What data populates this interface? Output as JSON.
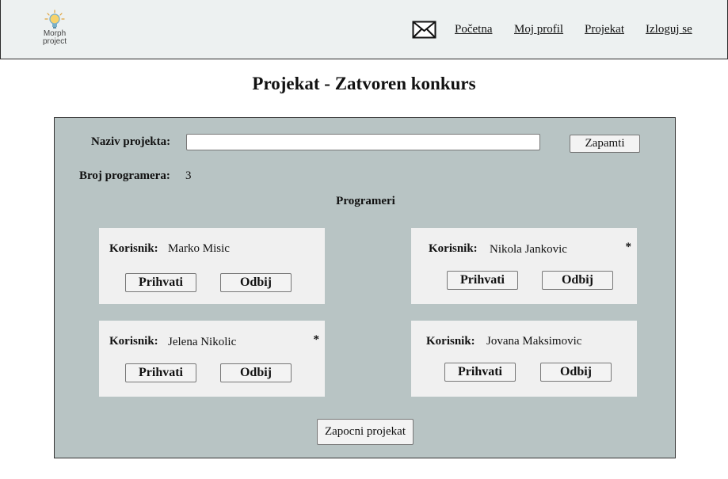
{
  "logo": {
    "line1": "Morph",
    "line2": "project"
  },
  "nav": {
    "mail_icon": "mail-icon",
    "links": [
      "Početna",
      "Moj profil",
      "Projekat",
      "Izloguj se"
    ]
  },
  "page": {
    "title": "Projekat - Zatvoren konkurs"
  },
  "form": {
    "name_label": "Naziv projekta:",
    "name_value": "",
    "save_label": "Zapamti",
    "count_label": "Broj programera:",
    "count_value": "3",
    "section_title": "Programeri"
  },
  "programmers": [
    {
      "user_label": "Korisnik:",
      "name": "Marko Misic",
      "marked": "",
      "accept": "Prihvati",
      "reject": "Odbij"
    },
    {
      "user_label": "Korisnik:",
      "name": "Nikola Jankovic",
      "marked": "*",
      "accept": "Prihvati",
      "reject": "Odbij"
    },
    {
      "user_label": "Korisnik:",
      "name": "Jelena Nikolic",
      "marked": "*",
      "accept": "Prihvati",
      "reject": "Odbij"
    },
    {
      "user_label": "Korisnik:",
      "name": "Jovana Maksimovic",
      "marked": "",
      "accept": "Prihvati",
      "reject": "Odbij"
    }
  ],
  "actions": {
    "start_label": "Zapocni projekat"
  }
}
